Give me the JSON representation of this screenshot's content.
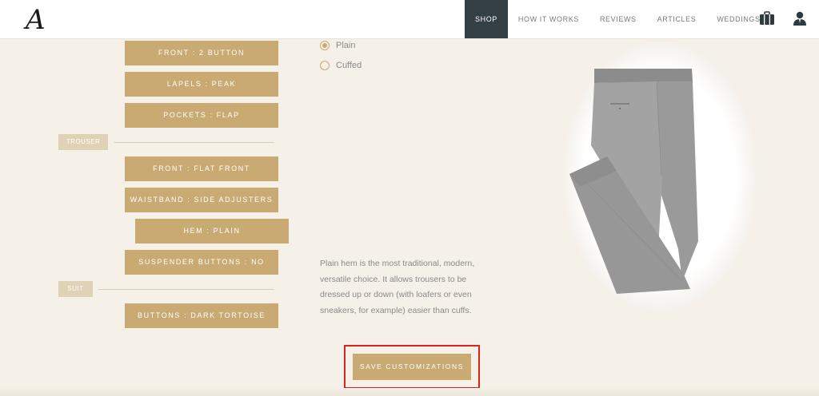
{
  "header": {
    "logo_letter": "A",
    "nav": [
      {
        "label": "SHOP",
        "active": true
      },
      {
        "label": "HOW IT WORKS",
        "active": false
      },
      {
        "label": "REVIEWS",
        "active": false
      },
      {
        "label": "ARTICLES",
        "active": false
      },
      {
        "label": "WEDDINGS",
        "active": false
      }
    ],
    "icons": [
      "briefcase-icon",
      "user-icon"
    ]
  },
  "options": {
    "jacket": [
      {
        "label": "FRONT : 2 BUTTON"
      },
      {
        "label": "LAPELS : PEAK"
      },
      {
        "label": "POCKETS : FLAP"
      }
    ],
    "trouser_section": "TROUSER",
    "trouser": [
      {
        "label": "FRONT : FLAT FRONT"
      },
      {
        "label": "WAISTBAND : SIDE ADJUSTERS"
      },
      {
        "label": "HEM : PLAIN"
      },
      {
        "label": "SUSPENDER BUTTONS : NO"
      }
    ],
    "suit_section": "SUIT",
    "suit": [
      {
        "label": "BUTTONS : DARK TORTOISE"
      }
    ]
  },
  "hem_choices": [
    {
      "label": "Plain",
      "checked": true
    },
    {
      "label": "Cuffed",
      "checked": false
    }
  ],
  "description": "Plain hem is the most traditional, modern, versatile choice. It allows trousers to be dressed up or down (with loafers or even sneakers, for example) easier than cuffs.",
  "save_label": "SAVE CUSTOMIZATIONS",
  "colors": {
    "accent": "#c9aa72",
    "nav_active": "#343e45",
    "background": "#f5f0e8",
    "highlight": "#e0221e"
  }
}
